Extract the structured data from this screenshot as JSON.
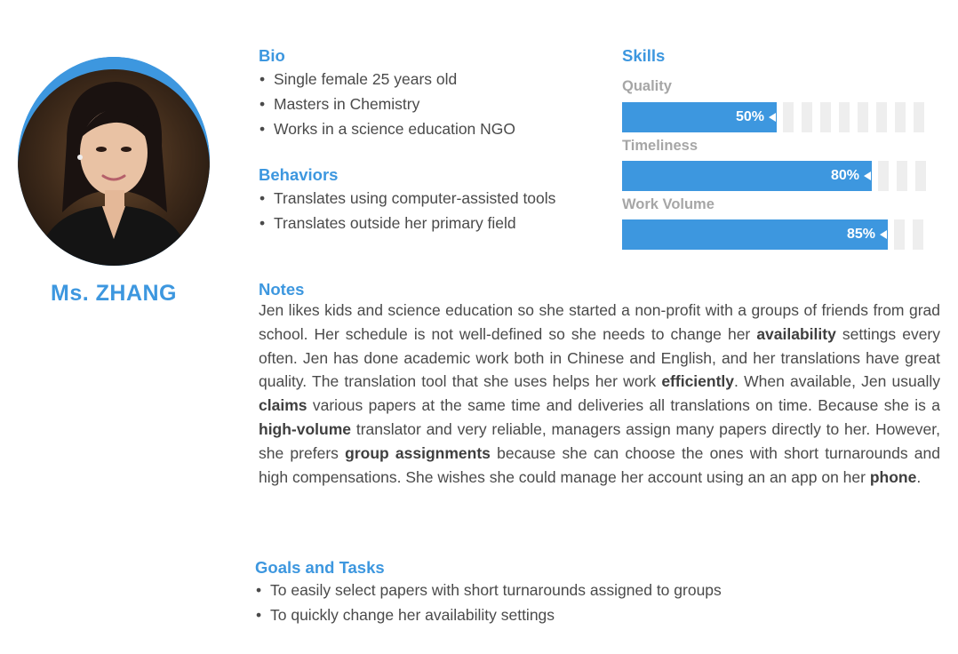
{
  "persona": {
    "name": "Ms. ZHANG"
  },
  "bio": {
    "heading": "Bio",
    "items": [
      "Single female 25 years old",
      "Masters in Chemistry",
      "Works in a science education NGO"
    ]
  },
  "behaviors": {
    "heading": "Behaviors",
    "items": [
      "Translates using computer-assisted tools",
      "Translates outside her primary field"
    ]
  },
  "skills": {
    "heading": "Skills",
    "items": [
      {
        "label": "Quality",
        "value": 50,
        "value_label": "50%"
      },
      {
        "label": "Timeliness",
        "value": 80,
        "value_label": "80%"
      },
      {
        "label": "Work Volume",
        "value": 85,
        "value_label": "85%"
      }
    ]
  },
  "notes": {
    "heading": "Notes",
    "segments": [
      {
        "text": "Jen likes kids and science education so she started a non-profit with a groups of friends from grad school. Her schedule is not well-defined so she needs to change her ",
        "bold": false
      },
      {
        "text": "availability",
        "bold": true
      },
      {
        "text": " settings every often. Jen has done academic work both in Chinese and English, and her translations have great quality. The translation tool that she uses helps her work ",
        "bold": false
      },
      {
        "text": "efficiently",
        "bold": true
      },
      {
        "text": ". When available, Jen usually ",
        "bold": false
      },
      {
        "text": "claims",
        "bold": true
      },
      {
        "text": " various papers at the same time and deliveries all translations on time. Because she is a ",
        "bold": false
      },
      {
        "text": "high-volume",
        "bold": true
      },
      {
        "text": " translator and very reliable, managers assign many papers directly to her. However, she prefers ",
        "bold": false
      },
      {
        "text": "group assignments",
        "bold": true
      },
      {
        "text": " because she can choose the ones with short turnarounds and high compensations. She wishes she could manage her account using an an app on her ",
        "bold": false
      },
      {
        "text": "phone",
        "bold": true
      },
      {
        "text": ".",
        "bold": false
      }
    ]
  },
  "goals": {
    "heading": "Goals and Tasks",
    "items": [
      "To easily select papers with short turnarounds assigned to groups",
      "To quickly change her availability settings"
    ]
  },
  "colors": {
    "accent": "#3d97df",
    "track": "#eeeeee",
    "label_gray": "#a6a6a6",
    "text": "#4a4a4a"
  }
}
